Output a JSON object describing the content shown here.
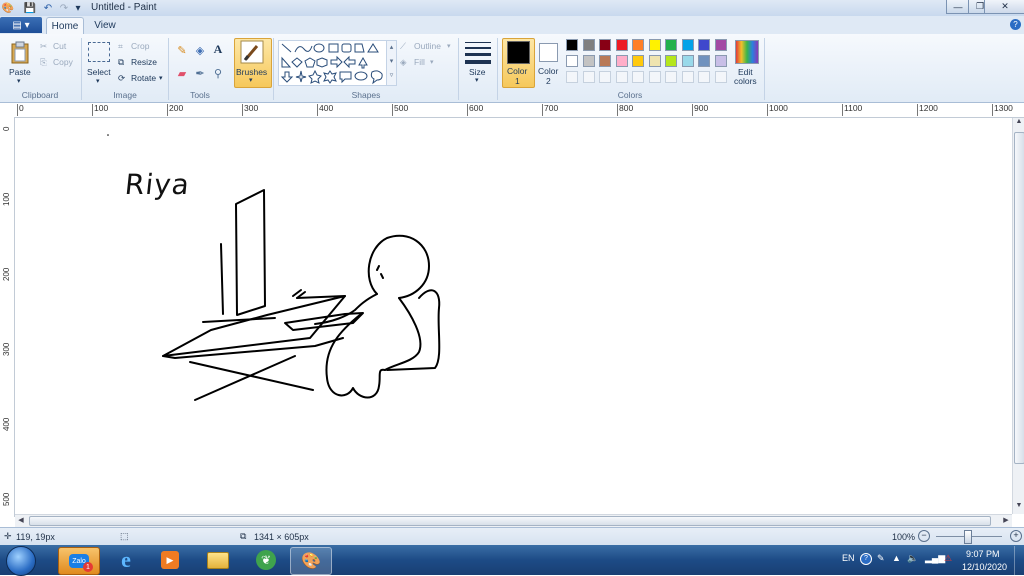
{
  "window": {
    "title": "Untitled - Paint",
    "minimize": "—",
    "maximize": "❐",
    "close": "✕"
  },
  "tabs": {
    "file": "▤ ▾",
    "home": "Home",
    "view": "View"
  },
  "ribbon": {
    "clipboard": {
      "paste": "Paste",
      "cut": "Cut",
      "copy": "Copy",
      "label": "Clipboard"
    },
    "image": {
      "select": "Select",
      "crop": "Crop",
      "resize": "Resize",
      "rotate": "Rotate",
      "label": "Image"
    },
    "tools": {
      "label": "Tools"
    },
    "brushes": {
      "label": "Brushes"
    },
    "shapes": {
      "outline": "Outline",
      "fill": "Fill",
      "label": "Shapes"
    },
    "size": {
      "label": "Size"
    },
    "color1": {
      "label": "Color",
      "num": "1"
    },
    "color2": {
      "label": "Color",
      "num": "2"
    },
    "colors": {
      "label": "Colors",
      "edit_line1": "Edit",
      "edit_line2": "colors"
    },
    "palette_row1": [
      "#000000",
      "#7f7f7f",
      "#880015",
      "#ed1c24",
      "#ff7f27",
      "#fff200",
      "#22b14c",
      "#00a2e8",
      "#3f48cc",
      "#a349a4"
    ],
    "palette_row2": [
      "#ffffff",
      "#c3c3c3",
      "#b97a57",
      "#ffaec9",
      "#ffc90e",
      "#efe4b0",
      "#b5e61d",
      "#99d9ea",
      "#7092be",
      "#c8bfe7"
    ]
  },
  "ruler": {
    "h_ticks": [
      "0",
      "100",
      "200",
      "300",
      "400",
      "500",
      "600",
      "700",
      "800",
      "900",
      "1000",
      "1100",
      "1200",
      "1300"
    ],
    "v_ticks": [
      "0",
      "100",
      "200",
      "300",
      "400",
      "500"
    ]
  },
  "canvas": {
    "handwriting": "Riya"
  },
  "status": {
    "cursor_pos": "119, 19px",
    "canvas_size": "1341 × 605px",
    "zoom": "100%"
  },
  "taskbar": {
    "time": "9:07 PM",
    "date": "12/10/2020",
    "lang": "EN",
    "zalo_label": "Zalo",
    "zalo_badge": "1"
  }
}
